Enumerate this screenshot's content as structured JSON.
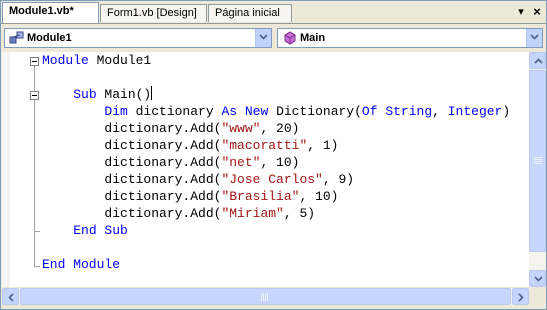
{
  "tabs": [
    {
      "label": "Module1.vb*",
      "active": true
    },
    {
      "label": "Form1.vb [Design]",
      "active": false
    },
    {
      "label": "Página inicial",
      "active": false
    }
  ],
  "tab_controls": {
    "dropdown_glyph": "▾",
    "close_glyph": "×"
  },
  "navbar": {
    "left_combo": {
      "selected": "Module1",
      "icon": "module-icon"
    },
    "right_combo": {
      "selected": "Main",
      "icon": "method-icon"
    }
  },
  "code_lines": [
    [
      {
        "t": "Module",
        "k": "kw"
      },
      {
        "t": " Module1"
      }
    ],
    [],
    [
      {
        "t": "    "
      },
      {
        "t": "Sub",
        "k": "kw"
      },
      {
        "t": " Main()"
      }
    ],
    [
      {
        "t": "        "
      },
      {
        "t": "Dim",
        "k": "kw"
      },
      {
        "t": " dictionary "
      },
      {
        "t": "As",
        "k": "kw"
      },
      {
        "t": " "
      },
      {
        "t": "New",
        "k": "kw"
      },
      {
        "t": " Dictionary("
      },
      {
        "t": "Of",
        "k": "kw"
      },
      {
        "t": " "
      },
      {
        "t": "String",
        "k": "kw"
      },
      {
        "t": ", "
      },
      {
        "t": "Integer",
        "k": "kw"
      },
      {
        "t": ")"
      }
    ],
    [
      {
        "t": "        dictionary.Add("
      },
      {
        "t": "\"www\"",
        "k": "str"
      },
      {
        "t": ", 20)"
      }
    ],
    [
      {
        "t": "        dictionary.Add("
      },
      {
        "t": "\"macoratti\"",
        "k": "str"
      },
      {
        "t": ", 1)"
      }
    ],
    [
      {
        "t": "        dictionary.Add("
      },
      {
        "t": "\"net\"",
        "k": "str"
      },
      {
        "t": ", 10)"
      }
    ],
    [
      {
        "t": "        dictionary.Add("
      },
      {
        "t": "\"Jose Carlos\"",
        "k": "str"
      },
      {
        "t": ", 9)"
      }
    ],
    [
      {
        "t": "        dictionary.Add("
      },
      {
        "t": "\"Brasilia\"",
        "k": "str"
      },
      {
        "t": ", 10)"
      }
    ],
    [
      {
        "t": "        dictionary.Add("
      },
      {
        "t": "\"Miriam\"",
        "k": "str"
      },
      {
        "t": ", 5)"
      }
    ],
    [
      {
        "t": "    "
      },
      {
        "t": "End Sub",
        "k": "kw"
      }
    ],
    [],
    [
      {
        "t": "End Module",
        "k": "kw"
      }
    ]
  ],
  "caret_line": 2,
  "colors": {
    "keyword": "#0000ff",
    "string": "#a31515",
    "text": "#000000"
  },
  "scrollbars": {
    "vertical_position": 0.0,
    "horizontal_position": 0.0
  }
}
